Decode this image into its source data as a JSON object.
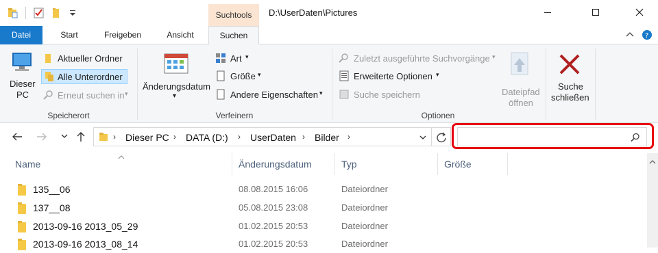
{
  "window": {
    "contextual_tab_group": "Suchtools",
    "title": "D:\\UserDaten\\Pictures",
    "minimize_icon": "minimize-icon",
    "maximize_icon": "maximize-icon",
    "close_icon": "close-icon"
  },
  "tabs": {
    "datei": "Datei",
    "start": "Start",
    "freigeben": "Freigeben",
    "ansicht": "Ansicht",
    "suchen": "Suchen"
  },
  "ribbon": {
    "speicherort": {
      "dieser_pc_line1": "Dieser",
      "dieser_pc_line2": "PC",
      "aktueller_ordner": "Aktueller Ordner",
      "alle_unterordner": "Alle Unterordner",
      "erneut_suchen": "Erneut suchen in",
      "group_label": "Speicherort"
    },
    "verfeinern": {
      "aenderungsdatum": "Änderungsdatum",
      "art": "Art",
      "groesse": "Größe",
      "andere_eigenschaften": "Andere Eigenschaften",
      "group_label": "Verfeinern"
    },
    "optionen": {
      "zuletzt": "Zuletzt ausgeführte Suchvorgänge",
      "erweiterte": "Erweiterte Optionen",
      "suche_speichern": "Suche speichern",
      "dateipfad_line1": "Dateipfad",
      "dateipfad_line2": "öffnen",
      "group_label": "Optionen"
    },
    "schliessen": {
      "line1": "Suche",
      "line2": "schließen"
    }
  },
  "address": {
    "crumbs": [
      "Dieser PC",
      "DATA (D:)",
      "UserDaten",
      "Bilder"
    ],
    "search_placeholder": ""
  },
  "list": {
    "columns": [
      "Name",
      "Änderungsdatum",
      "Typ",
      "Größe"
    ],
    "rows": [
      {
        "name": "135__06",
        "date": "08.08.2015 16:06",
        "type": "Dateiordner"
      },
      {
        "name": "137__08",
        "date": "05.08.2015 23:08",
        "type": "Dateiordner"
      },
      {
        "name": "2013-09-16 2013_05_29",
        "date": "01.02.2015 20:53",
        "type": "Dateiordner"
      },
      {
        "name": "2013-09-16 2013_08_14",
        "date": "01.02.2015 20:53",
        "type": "Dateiordner"
      }
    ]
  },
  "colors": {
    "accent": "#1979ca",
    "contextual": "#fbe4d2",
    "highlight": "#e8000d"
  }
}
